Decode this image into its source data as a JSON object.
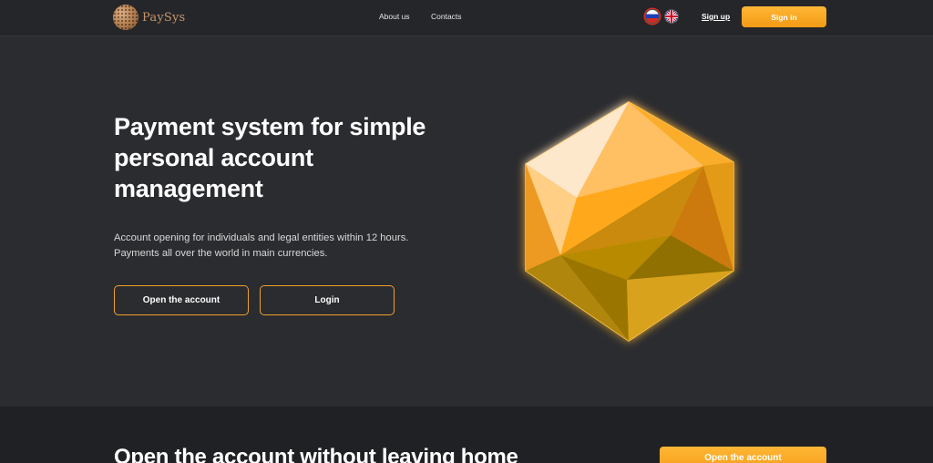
{
  "brand": {
    "name": "PaySys",
    "logo_icon": "paysys-globe-logo"
  },
  "nav": {
    "about": "About us",
    "contacts": "Contacts"
  },
  "languages": [
    {
      "code": "ru",
      "icon": "russia-flag-icon"
    },
    {
      "code": "en",
      "icon": "uk-flag-icon"
    }
  ],
  "auth": {
    "signup": "Sign up",
    "signin": "Sign in"
  },
  "hero": {
    "title": "Payment system for simple personal account management",
    "description_line1": "Account opening for individuals and legal entities within 12 hours.",
    "description_line2": "Payments all over the world in main currencies.",
    "open_account": "Open the account",
    "login": "Login"
  },
  "section2": {
    "title": "Open the account without leaving home",
    "button": "Open the account"
  },
  "colors": {
    "background": "#2b2c30",
    "header": "#25262a",
    "accent": "#f5a623",
    "section2": "#202124"
  }
}
